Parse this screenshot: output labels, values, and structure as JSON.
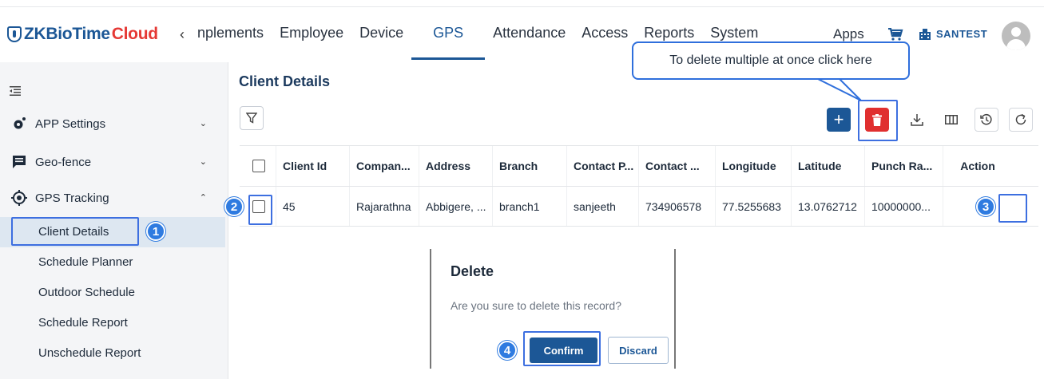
{
  "header": {
    "logo_main": "ZKBioTime",
    "logo_accent": "Cloud",
    "nav_prev": "‹",
    "nav_items": [
      {
        "label": "nplements",
        "active": false
      },
      {
        "label": "Employee",
        "active": false
      },
      {
        "label": "Device",
        "active": false
      },
      {
        "label": "GPS",
        "active": true
      },
      {
        "label": "Attendance",
        "active": false
      },
      {
        "label": "Access",
        "active": false
      },
      {
        "label": "Reports",
        "active": false
      },
      {
        "label": "System",
        "active": false
      }
    ],
    "apps_label": "Apps",
    "company_name": "SANTEST"
  },
  "sidebar": {
    "groups": [
      {
        "label": "APP Settings",
        "icon": "gear-icon",
        "expanded": false
      },
      {
        "label": "Geo-fence",
        "icon": "message-square-icon",
        "expanded": false
      },
      {
        "label": "GPS Tracking",
        "icon": "location-target-icon",
        "expanded": true
      }
    ],
    "sub_items": [
      {
        "label": "Client Details",
        "active": true
      },
      {
        "label": "Schedule Planner",
        "active": false
      },
      {
        "label": "Outdoor Schedule",
        "active": false
      },
      {
        "label": "Schedule Report",
        "active": false
      },
      {
        "label": "Unschedule Report",
        "active": false
      }
    ]
  },
  "main": {
    "title": "Client Details",
    "table": {
      "columns": [
        "Client Id",
        "Compan...",
        "Address",
        "Branch",
        "Contact P...",
        "Contact ...",
        "Longitude",
        "Latitude",
        "Punch Ra...",
        "Action"
      ],
      "rows": [
        [
          "45",
          "Rajarathna",
          "Abbigere, ...",
          "branch1",
          "sanjeeth",
          "734906578",
          "77.5255683",
          "13.0762712",
          "10000000..."
        ]
      ]
    }
  },
  "dialog": {
    "title": "Delete",
    "message": "Are you sure to delete this record?",
    "confirm_label": "Confirm",
    "discard_label": "Discard"
  },
  "annotations": {
    "callout": "To delete multiple at once click here",
    "badges": [
      "1",
      "2",
      "3",
      "4"
    ]
  },
  "colors": {
    "primary": "#1c5796",
    "danger": "#e02f2f",
    "highlight": "#3d6fe0",
    "badge": "#2f7be0"
  }
}
